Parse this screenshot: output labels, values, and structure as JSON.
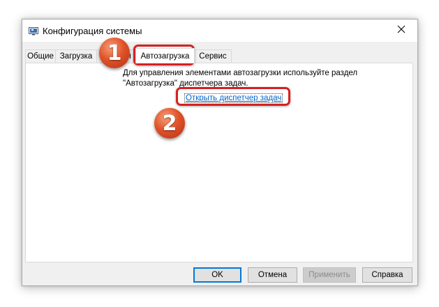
{
  "window": {
    "title": "Конфигурация системы",
    "icon": "msconfig-icon",
    "close_icon": "close-icon"
  },
  "tabs": [
    {
      "label": "Общие",
      "active": false
    },
    {
      "label": "Загрузка",
      "active": false
    },
    {
      "label": "Службы",
      "active": false
    },
    {
      "label": "Автозагрузка",
      "active": true
    },
    {
      "label": "Сервис",
      "active": false
    }
  ],
  "startup": {
    "description_line1": "Для управления элементами автозагрузки используйте раздел",
    "description_line2": "\"Автозагрузка\" диспетчера задач.",
    "link": "Открыть диспетчер задач"
  },
  "buttons": {
    "ok": "OK",
    "cancel": "Отмена",
    "apply": "Применить",
    "help": "Справка"
  },
  "annotations": {
    "step1": "1",
    "step2": "2"
  },
  "colors": {
    "link": "#0066cc",
    "highlight": "#d62020",
    "badge": "#e0532a",
    "default_button_border": "#0078d7"
  }
}
